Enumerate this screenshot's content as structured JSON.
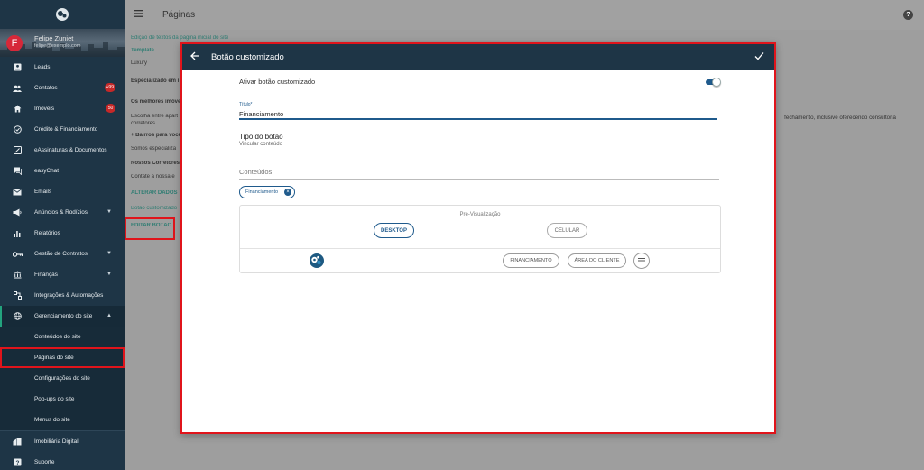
{
  "topbar": {
    "title": "Páginas"
  },
  "profile": {
    "initial": "F",
    "name": "Felipe Zuniet",
    "email": "felipe@exemplo.com"
  },
  "sidebar": {
    "items": [
      {
        "label": "Leads",
        "icon": "person-card-icon"
      },
      {
        "label": "Contatos",
        "icon": "people-icon",
        "badge": "+99"
      },
      {
        "label": "Imóveis",
        "icon": "home-icon",
        "badge": "50"
      },
      {
        "label": "Crédito & Financiamento",
        "icon": "check-circle-icon"
      },
      {
        "label": "eAssinaturas & Documentos",
        "icon": "signature-icon"
      },
      {
        "label": "easyChat",
        "icon": "chat-icon"
      },
      {
        "label": "Emails",
        "icon": "mail-icon"
      },
      {
        "label": "Anúncios & Rodízios",
        "icon": "megaphone-icon"
      },
      {
        "label": "Relatórios",
        "icon": "bar-chart-icon"
      },
      {
        "label": "Gestão de Contratos",
        "icon": "key-icon"
      },
      {
        "label": "Finanças",
        "icon": "bank-icon"
      },
      {
        "label": "Integrações & Automações",
        "icon": "integration-icon"
      },
      {
        "label": "Gerenciamento do site",
        "icon": "globe-icon"
      }
    ],
    "subitems": [
      "Conteúdos do site",
      "Páginas do site",
      "Configurações do site",
      "Pop-ups do site",
      "Menus do site"
    ],
    "bottom": [
      {
        "label": "Imobiliária Digital",
        "icon": "building-icon"
      },
      {
        "label": "Suporte",
        "icon": "support-icon"
      }
    ]
  },
  "background": {
    "edit_title": "Edição de textos da página inicial do site",
    "template_label": "Template",
    "template_value": "Luxury",
    "specialized": "Especializado em i",
    "best": "Os melhores imóve",
    "choose": "Escolha entre apart",
    "brokers": "corretores",
    "bairros": "+ Bairros para você",
    "somos": "Somos especializa",
    "nossos": "Nossos Corretores",
    "contate": "Contate a nossa e",
    "alterar": "ALTERAR DADOS",
    "botao": "Botão customizado",
    "editar": "EDITAR BOTÃO",
    "right_text": "fechamento, inclusive oferecendo consultoria"
  },
  "dialog": {
    "title": "Botão customizado",
    "toggle_label": "Ativar botão customizado",
    "field_label": "Título*",
    "field_value": "Financiamento",
    "tipo_title": "Tipo do botão",
    "tipo_sub": "Vincular conteúdo",
    "conteudos_label": "Conteúdos",
    "chip": "Financiamento",
    "preview": {
      "title": "Pre-Visualização",
      "desktop": "DESKTOP",
      "celular": "CELULAR",
      "nav_financiamento": "FINANCIAMENTO",
      "nav_area": "ÁREA DO CLIENTE"
    }
  },
  "colors": {
    "sidebar": "#1e3546",
    "accent": "#1f5a8c",
    "highlight": "#e0141b",
    "badge": "#c62828"
  }
}
